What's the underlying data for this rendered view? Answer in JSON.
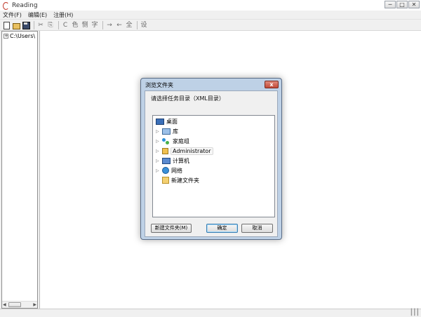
{
  "app": {
    "title": "Reading"
  },
  "window_controls": {
    "minimize": "─",
    "maximize": "□",
    "close": "✕"
  },
  "menu": [
    "文件(F)",
    "编辑(E)",
    "注册(H)"
  ],
  "toolbar": {
    "buttons": [
      {
        "icon": "new-file-icon"
      },
      {
        "icon": "open-folder-icon"
      },
      {
        "icon": "save-icon"
      },
      {
        "icon": "cut-icon",
        "glyph": "✂"
      },
      {
        "icon": "copy-icon",
        "glyph": "⎘"
      },
      {
        "icon": "convert-c-icon",
        "glyph": "C"
      },
      {
        "icon": "color-icon",
        "glyph": "色"
      },
      {
        "icon": "compare-icon",
        "glyph": "恻"
      },
      {
        "icon": "char-icon",
        "glyph": "字"
      },
      {
        "icon": "forward-icon",
        "glyph": "→"
      },
      {
        "icon": "back-icon",
        "glyph": "←"
      },
      {
        "icon": "all-icon",
        "glyph": "全"
      },
      {
        "icon": "settings-icon",
        "glyph": "设"
      }
    ]
  },
  "left_tree": {
    "root_label": "C:\\Users\\",
    "expander": "+"
  },
  "scrollbar": {
    "left": "◀",
    "right": "▶"
  },
  "statusbar": {
    "grip": "┃┃┃"
  },
  "dialog": {
    "title": "浏览文件夹",
    "close_label": "x",
    "prompt": "请选择任务目录（XML目录）",
    "tree": [
      {
        "label": "桌面",
        "icon": "desktop-icon",
        "expandable": false,
        "level": 0
      },
      {
        "label": "库",
        "icon": "library-icon",
        "expandable": true,
        "level": 1
      },
      {
        "label": "家庭组",
        "icon": "homegroup-icon",
        "expandable": true,
        "level": 1
      },
      {
        "label": "Administrator",
        "icon": "user-folder-icon",
        "expandable": true,
        "level": 1
      },
      {
        "label": "计算机",
        "icon": "computer-icon",
        "expandable": true,
        "level": 1
      },
      {
        "label": "网络",
        "icon": "network-icon",
        "expandable": true,
        "level": 1
      },
      {
        "label": "新建文件夹",
        "icon": "folder-icon",
        "expandable": false,
        "level": 1
      }
    ],
    "buttons": {
      "new_folder": "新建文件夹(M)",
      "ok": "确定",
      "cancel": "取消"
    }
  }
}
